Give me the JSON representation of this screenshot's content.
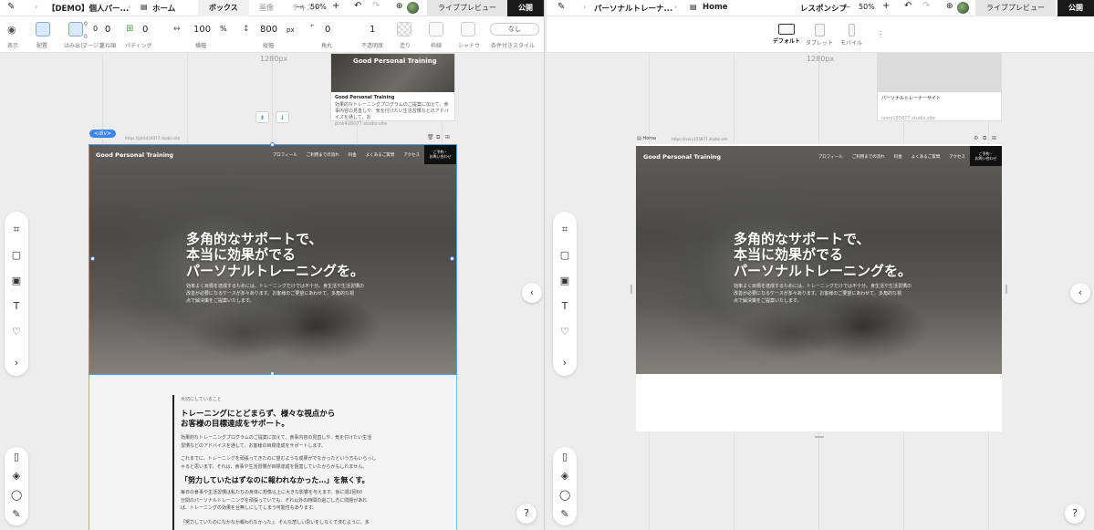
{
  "left": {
    "topbar": {
      "site_title": "【DEMO】個人パー...",
      "page_label": "ホーム",
      "tab_box": "ボックス",
      "tab_image": "画像",
      "tab_text": "テキスト",
      "zoom": "50%",
      "preview": "ライブプレビュー",
      "publish": "公開"
    },
    "toolbar": {
      "display_label": "表示",
      "layout_label": "配置",
      "overflow_label": "はみ出し",
      "margin_label": "マージン",
      "wrap_label": "重ね順",
      "margin_top": "0",
      "margin_bottom": "0",
      "zindex_value": "0",
      "padding_value": "0",
      "padding_label": "パディング",
      "width_value": "100",
      "width_unit": "%",
      "width_label": "横幅",
      "height_value": "800",
      "height_unit": "px",
      "height_label": "縦幅",
      "radius_value": "0",
      "radius_label": "角丸",
      "opacity_value": "1",
      "opacity_label": "不透明度",
      "fill_label": "塗り",
      "border_label": "枠線",
      "shadow_label": "シャドウ",
      "none_label": "なし",
      "multi_label": "条件付きスタイル"
    },
    "canvas": {
      "width_label": "1280px",
      "div_badge": "<div>",
      "url_label": "https://pink416077.studio.site",
      "thumb_title": "Good Personal Training",
      "thumb_desc": "効果的なトレーニングプログラムのご提案に加えて、食事内容の見直しや、気を付けたい生活習慣などのアドバイスを通して、お",
      "thumb_url": "pink416077.studio.site"
    }
  },
  "right": {
    "topbar": {
      "page_title": "パーソナルトレーナ...",
      "page_label": "Home",
      "responsive": "レスポンシブ",
      "zoom": "50%",
      "preview": "ライブプレビュー",
      "publish": "公開"
    },
    "devices": [
      "デフォルト",
      "タブレット",
      "モバイル"
    ],
    "canvas": {
      "width_label": "1280px",
      "thumb_title": "パーソナルトレーナーサイト",
      "thumb_url": "ivory155877.studio.site",
      "page_tab": "Home",
      "url_label": "https://ivory155877.studio.site"
    }
  },
  "hero": {
    "logo": "Good Personal Training",
    "nav": [
      "プロフィール",
      "ご利用までの流れ",
      "料金",
      "よくあるご質問",
      "アクセス"
    ],
    "cta_line1": "ご予約・",
    "cta_line2": "お問い合わせ",
    "headline_1": "多角的なサポートで、",
    "headline_2": "本当に効果がでる",
    "headline_3": "パーソナルトレーニングを。",
    "body_1": "効率よく目標を達成するためには、トレーニングだけでは不十分。食生活や生活習慣の",
    "body_2": "改善が必要になるケースが多々あります。お客様のご要望にあわせて、多角的な視",
    "body_3": "点で解決策をご提案いたします。"
  },
  "content": {
    "small_label": "大切にしていること",
    "heading_1": "トレーニングにとどまらず、様々な視点から",
    "heading_2": "お客様の目標達成をサポート。",
    "p1_a": "効果的なトレーニングプログラムのご提案に加えて、食事内容の見直しや、気を付けたい生活",
    "p1_b": "習慣などのアドバイスを通して、お客様の目標達成をサポートします。",
    "p2_a": "これまでに、トレーニングを頑張ってきたのに望むような成果がでなかったという方もいらっし",
    "p2_b": "ゃると思います。それは、食事や生活習慣が目標達成を阻害していたからかもしれません。",
    "sub_heading": "「努力していたはずなのに報われなかった…」を無くす。",
    "p3_a": "毎日の食事や生活習慣は私たちの身体に想像以上に大きな影響を与えます。仮に週2回60",
    "p3_b": "分間のパーソナルトレーニングを頑張っていても、それ以外の時間の過ごし方に問題があれ",
    "p3_c": "ば、トレーニングの効果を台無しにしてしまう可能性もあります。",
    "p4_a": "「努力していたのになかなか報われなかった」、そんな悲しい思いをしなくて済むように、多"
  },
  "help": "?",
  "colors": {
    "accent": "#3d86ef",
    "publish_bg": "#1a1a1a"
  }
}
